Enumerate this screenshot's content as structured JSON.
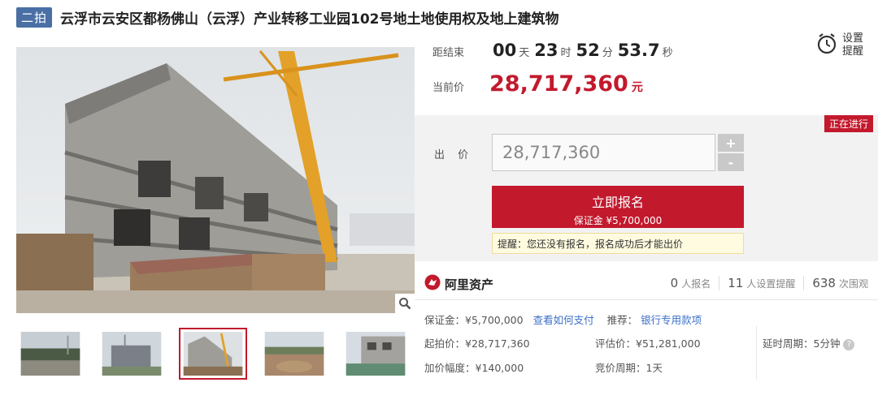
{
  "header": {
    "round_badge": "二拍",
    "title": "云浮市云安区都杨佛山（云浮）产业转移工业园102号地土地使用权及地上建筑物"
  },
  "countdown": {
    "label": "距结束",
    "days": "00",
    "days_unit": "天",
    "hours": "23",
    "hours_unit": "时",
    "minutes": "52",
    "minutes_unit": "分",
    "seconds": "53.7",
    "seconds_unit": "秒"
  },
  "current_price": {
    "label": "当前价",
    "value": "28,717,360",
    "unit": "元"
  },
  "reminder": {
    "label": "设置提醒"
  },
  "bid": {
    "status": "正在进行",
    "label": "出 价",
    "input_value": "28,717,360",
    "plus": "+",
    "minus": "-",
    "register_label": "立即报名",
    "deposit_line": "保证金 ¥5,700,000",
    "tip": "提醒：您还没有报名，报名成功后才能出价"
  },
  "brand": {
    "name": "阿里资产"
  },
  "stats": [
    {
      "num": "0",
      "label": "人报名"
    },
    {
      "num": "11",
      "label": "人设置提醒"
    },
    {
      "num": "638",
      "label": "次围观"
    }
  ],
  "details": {
    "deposit": "保证金：¥5,700,000",
    "pay_link": "查看如何支付",
    "recommend_label": "推荐：",
    "recommend_link": "银行专用款项",
    "start_price": "起拍价：¥28,717,360",
    "appraisal": "评估价：¥51,281,000",
    "delay": "延时周期：5分钟",
    "increment": "加价幅度：¥140,000",
    "bid_cycle": "竞价周期：1天"
  },
  "colors": {
    "accent": "#c3192d",
    "badge": "#4a6fa5",
    "link": "#3a6fc8"
  },
  "icons": [
    "alarm-clock-icon",
    "zoom-icon",
    "ali-asset-logo-icon",
    "help-icon"
  ]
}
